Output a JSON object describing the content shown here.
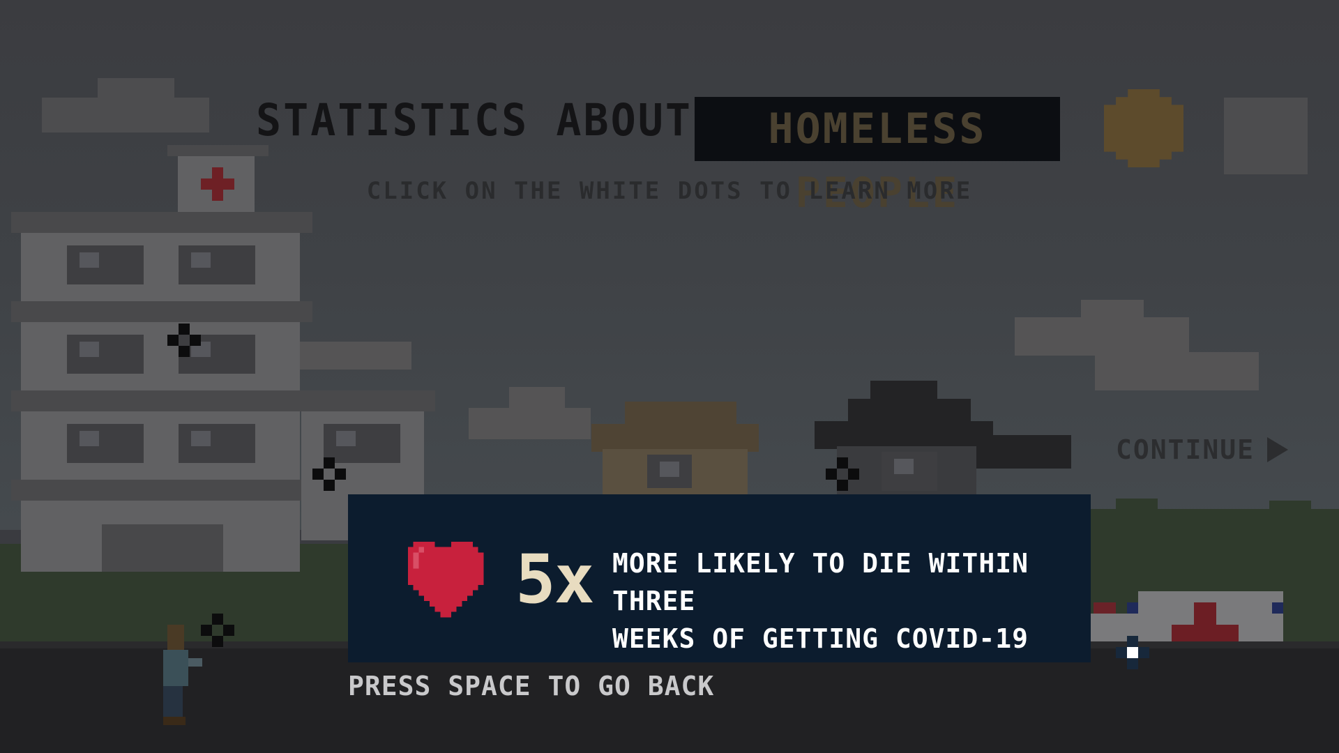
{
  "title": {
    "prefix": "STATISTICS ABOUT",
    "highlight": "HOMELESS PEOPLE"
  },
  "subtitle": "CLICK ON THE WHITE DOTS TO LEARN MORE",
  "continue_label": "CONTINUE",
  "stat": {
    "icon": "heart-icon",
    "number": "5x",
    "line1": "MORE LIKELY TO DIE WITHIN THREE",
    "line2": "WEEKS OF GETTING COVID-19"
  },
  "footer_hint": "PRESS SPACE TO GO BACK",
  "colors": {
    "panel_bg": "#0c1c2e",
    "heart": "#c8213d",
    "stat_number": "#e8dcc0",
    "highlight_bg": "#0c0e12"
  }
}
